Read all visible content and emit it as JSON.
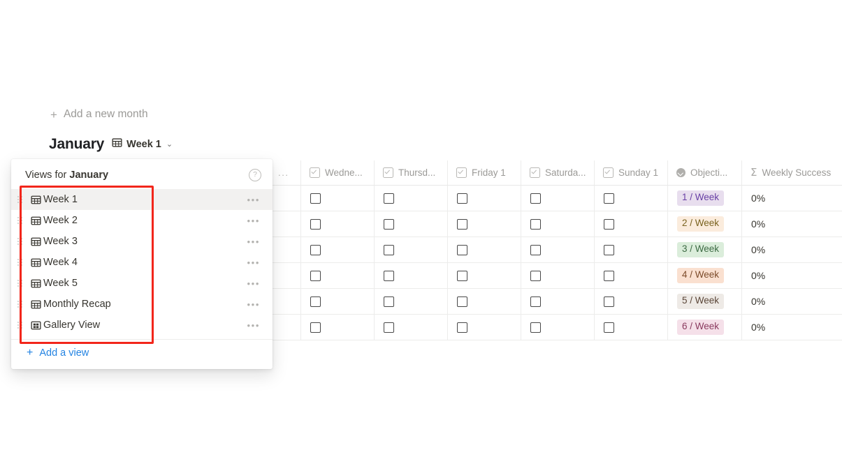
{
  "toolbar": {
    "add_month_label": "Add a new month",
    "add_month_icon": "plus-icon"
  },
  "month_header": {
    "title": "January",
    "view_icon": "table-view-icon",
    "current_view": "Week 1",
    "chevron": "⌄"
  },
  "views_popup": {
    "title_prefix": "Views for ",
    "title_month": "January",
    "help_icon": "?",
    "more_glyph": "•••",
    "items": [
      {
        "label": "Week 1",
        "icon": "table-view-icon",
        "selected": true
      },
      {
        "label": "Week 2",
        "icon": "table-view-icon",
        "selected": false
      },
      {
        "label": "Week 3",
        "icon": "table-view-icon",
        "selected": false
      },
      {
        "label": "Week 4",
        "icon": "table-view-icon",
        "selected": false
      },
      {
        "label": "Week 5",
        "icon": "table-view-icon",
        "selected": false
      },
      {
        "label": "Monthly Recap",
        "icon": "table-view-icon",
        "selected": false
      },
      {
        "label": "Gallery View",
        "icon": "gallery-view-icon",
        "selected": false
      }
    ],
    "add_view_label": "Add a view",
    "add_view_icon": "plus-icon"
  },
  "table": {
    "columns": [
      {
        "label": "...",
        "icon": "ellipsis",
        "kind": "stub"
      },
      {
        "label": "Wedne...",
        "icon": "checkbox-icon",
        "kind": "day"
      },
      {
        "label": "Thursd...",
        "icon": "checkbox-icon",
        "kind": "day"
      },
      {
        "label": "Friday 1",
        "icon": "checkbox-icon",
        "kind": "day"
      },
      {
        "label": "Saturda...",
        "icon": "checkbox-icon",
        "kind": "day"
      },
      {
        "label": "Sunday 1",
        "icon": "checkbox-icon",
        "kind": "day"
      },
      {
        "label": "Objecti...",
        "icon": "select-icon",
        "kind": "objective"
      },
      {
        "label": "Weekly Success",
        "icon": "formula-sigma-icon",
        "kind": "weekly"
      }
    ],
    "rows": [
      {
        "checks": [
          false,
          false,
          false,
          false,
          false
        ],
        "objective": "1 / Week",
        "objective_bg": "#e8deee",
        "objective_fg": "#6940a5",
        "weekly_success": "0%"
      },
      {
        "checks": [
          false,
          false,
          false,
          false,
          false
        ],
        "objective": "2 / Week",
        "objective_bg": "#fbecdd",
        "objective_fg": "#7a6320",
        "weekly_success": "0%"
      },
      {
        "checks": [
          false,
          false,
          false,
          false,
          false
        ],
        "objective": "3 / Week",
        "objective_bg": "#dbeddb",
        "objective_fg": "#3d6b44",
        "weekly_success": "0%"
      },
      {
        "checks": [
          false,
          false,
          false,
          false,
          false
        ],
        "objective": "4 / Week",
        "objective_bg": "#fae0d0",
        "objective_fg": "#7c4b2a",
        "weekly_success": "0%"
      },
      {
        "checks": [
          false,
          false,
          false,
          false,
          false
        ],
        "objective": "5 / Week",
        "objective_bg": "#eeeae6",
        "objective_fg": "#5b4638",
        "weekly_success": "0%"
      },
      {
        "checks": [
          false,
          false,
          false,
          false,
          false
        ],
        "objective": "6 / Week",
        "objective_bg": "#f5e0e9",
        "objective_fg": "#8a3a5f",
        "weekly_success": "0%"
      }
    ]
  },
  "annotation": {
    "highlight_color": "#f2261b"
  }
}
